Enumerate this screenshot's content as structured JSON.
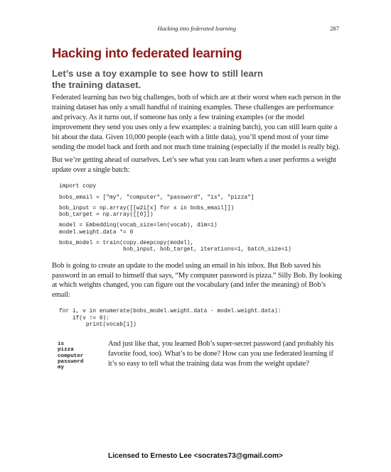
{
  "running_head": {
    "title": "Hacking into federated learning",
    "page_number": "287"
  },
  "heading": "Hacking into federated learning",
  "subheading": "Let’s use a toy example to see how to still learn the training dataset.",
  "paragraphs": {
    "intro": "Federated learning has two big challenges, both of which are at their worst when each person in the training dataset has only a small handful of training examples. These challenges are performance and privacy. As it turns out, if someone has only a few training examples (or the model improvement they send you uses only a few examples: a training batch), you can still learn quite a bit about the data. Given 10,000 people (each with a little data), you’ll spend most of your time sending the model back and forth and not much time training (especially if the model is really big).",
    "ahead": "But we’re getting ahead of ourselves. Let’s see what you can learn when a user performs a weight update over a single batch:",
    "bob": "Bob is going to create an update to the model using an email in his inbox. But Bob saved his password in an email to himself that says, “My computer password is pizza.” Silly Bob. By looking at which weights changed, you can figure out the vocabulary (and infer the meaning) of Bob’s email:",
    "conclusion": "And just like that, you learned Bob’s super-secret password (and probably his favorite food, too). What’s to be done? How can you use federated learning if it’s so easy to tell what the training data was from the weight update?"
  },
  "code_block_1": [
    "import copy",
    "",
    "bobs_email = [\"my\", \"computer\", \"password\", \"is\", \"pizza\"]",
    "",
    "bob_input = np.array([[w2i[x] for x in bobs_email]])",
    "bob_target = np.array([[0]])",
    "",
    "model = Embedding(vocab_size=len(vocab), dim=1)",
    "model.weight.data *= 0",
    "",
    "bobs_model = train(copy.deepcopy(model),",
    "                   bob_input, bob_target, iterations=1, batch_size=1)"
  ],
  "code_block_2": [
    "for i, v in enumerate(bobs_model.weight.data - model.weight.data):",
    "    if(v != 0):",
    "        print(vocab[i])"
  ],
  "output_words": [
    "is",
    "pizza",
    "computer",
    "password",
    "my"
  ],
  "footer_license": "Licensed to Ernesto Lee <socrates73@gmail.com>"
}
